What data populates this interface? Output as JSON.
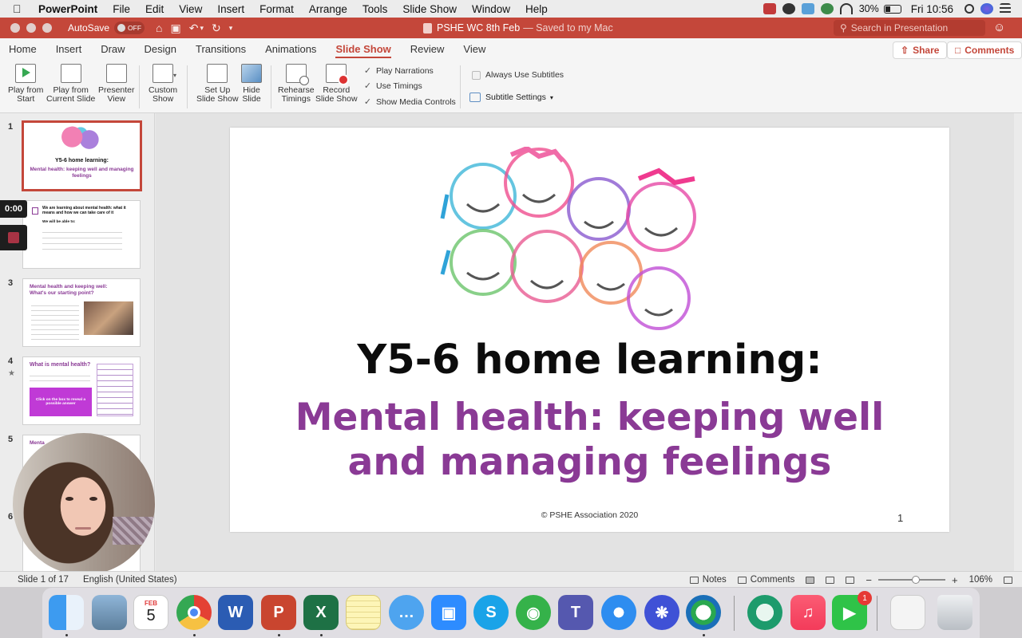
{
  "menubar": {
    "app_name": "PowerPoint",
    "items": [
      "File",
      "Edit",
      "View",
      "Insert",
      "Format",
      "Arrange",
      "Tools",
      "Slide Show",
      "Window",
      "Help"
    ],
    "battery": "30%",
    "clock": "Fri 10:56"
  },
  "titlebar": {
    "autosave_label": "AutoSave",
    "autosave_state": "OFF",
    "doc_title": "PSHE WC 8th Feb",
    "saved_status": "— Saved to my Mac",
    "search_placeholder": "Search in Presentation"
  },
  "ribbon_tabs": [
    "Home",
    "Insert",
    "Draw",
    "Design",
    "Transitions",
    "Animations",
    "Slide Show",
    "Review",
    "View"
  ],
  "active_tab": "Slide Show",
  "share_label": "Share",
  "comments_label": "Comments",
  "ribbon": {
    "play_from_start": [
      "Play from",
      "Start"
    ],
    "play_from_current": [
      "Play from",
      "Current Slide"
    ],
    "presenter_view": [
      "Presenter",
      "View"
    ],
    "custom_show": [
      "Custom",
      "Show"
    ],
    "set_up_slide_show": [
      "Set Up",
      "Slide Show"
    ],
    "hide_slide": [
      "Hide",
      "Slide"
    ],
    "rehearse_timings": [
      "Rehearse",
      "Timings"
    ],
    "record_slide_show": [
      "Record",
      "Slide Show"
    ],
    "play_narrations": "Play Narrations",
    "use_timings": "Use Timings",
    "show_media_controls": "Show Media Controls",
    "always_use_subtitles": "Always Use Subtitles",
    "subtitle_settings": "Subtitle Settings"
  },
  "thumbnails": {
    "numbers": [
      "1",
      "3",
      "4",
      "5",
      "6"
    ],
    "s1_title": "Y5-6 home learning:",
    "s1_sub": "Mental health: keeping well and managing feelings",
    "s2_title": "We are learning about mental health: what it means and how we can take care of it",
    "s2_able": "We will be able to:",
    "s3_title": "Mental health and keeping well: What's our starting point?",
    "s4_title": "What is mental health?",
    "s4_button": "Click on the box to reveal a possible answer",
    "s5_title": "Menta"
  },
  "recording": {
    "timer": "0:00"
  },
  "slide": {
    "title": "Y5-6 home learning:",
    "subtitle": "Mental health: keeping well and managing feelings",
    "copyright": "© PSHE Association 2020",
    "number": "1"
  },
  "statusbar": {
    "slide_of": "Slide 1 of 17",
    "language": "English (United States)",
    "notes": "Notes",
    "comments": "Comments",
    "zoom": "106%"
  },
  "dock": {
    "calendar_month": "FEB",
    "calendar_day": "5",
    "facetime_badge": "1"
  },
  "colors": {
    "accent_red": "#c4473a",
    "slide_purple": "#8a3a95"
  }
}
